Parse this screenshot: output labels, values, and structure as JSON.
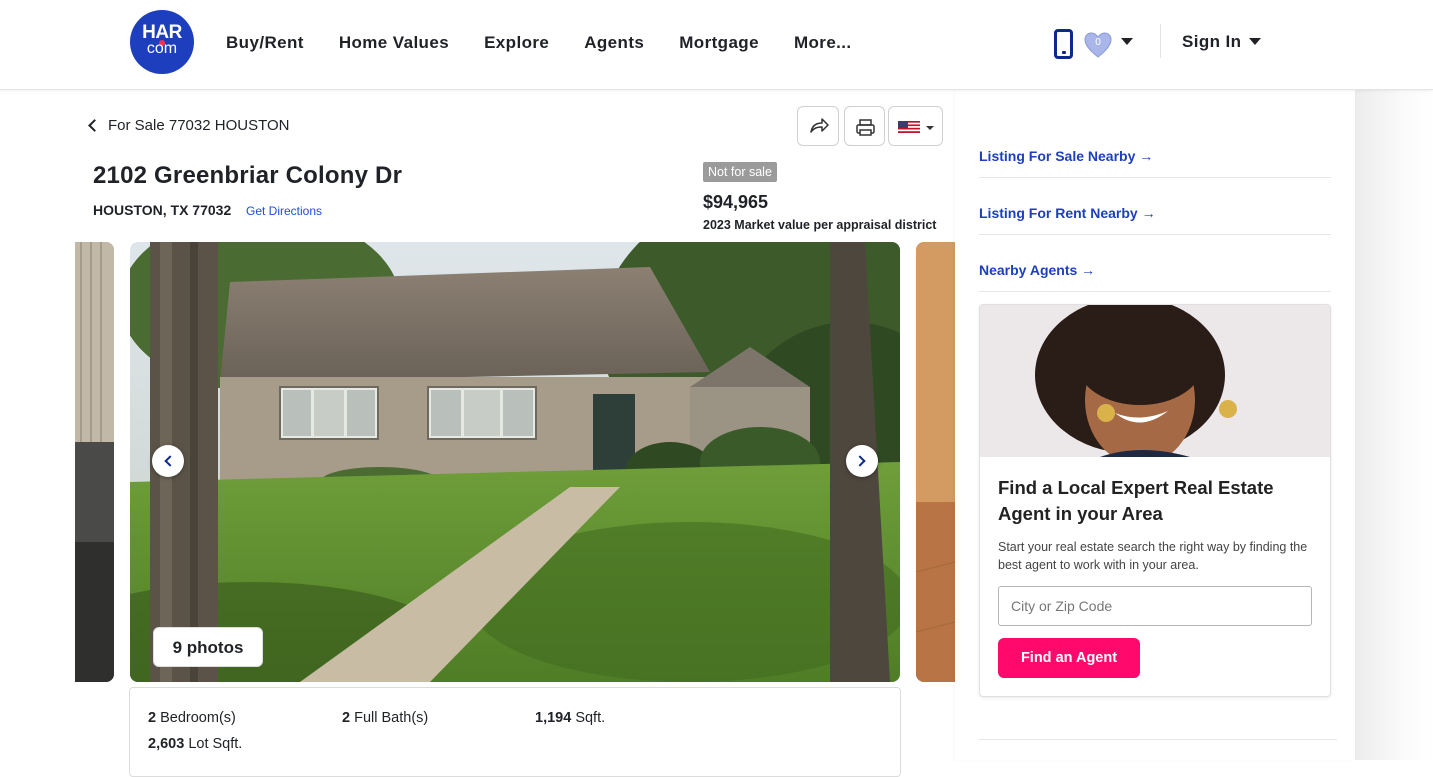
{
  "header": {
    "logo_top": "HAR",
    "logo_bottom": "com",
    "nav": [
      "Buy/Rent",
      "Home Values",
      "Explore",
      "Agents",
      "Mortgage",
      "More..."
    ],
    "favorites_count": "0",
    "sign_in": "Sign In",
    "brand_color": "#1d3fbd"
  },
  "listing": {
    "breadcrumb": "For Sale 77032 HOUSTON",
    "address": "2102 Greenbriar Colony Dr",
    "city_line": "HOUSTON, TX 77032",
    "directions": "Get Directions",
    "status_badge": "Not for sale",
    "price": "$94,965",
    "price_note": "2023 Market value per appraisal district",
    "photos_button": "9 photos",
    "facts": [
      {
        "value": "2",
        "label": " Bedroom(s)"
      },
      {
        "value": "2",
        "label": " Full Bath(s)"
      },
      {
        "value": "1,194",
        "label": " Sqft."
      },
      {
        "value": "2,603",
        "label": " Lot Sqft."
      }
    ]
  },
  "sidebar": {
    "links": [
      "Listing For Sale Nearby →",
      "Listing For Rent Nearby →",
      "Nearby Agents →"
    ],
    "card": {
      "title": "Find a Local Expert Real Estate Agent in your Area",
      "description": "Start your real estate search the right way by finding the best agent to work with in your area.",
      "input_placeholder": "City or Zip Code",
      "button": "Find an Agent",
      "button_color": "#ff0a6c"
    }
  }
}
